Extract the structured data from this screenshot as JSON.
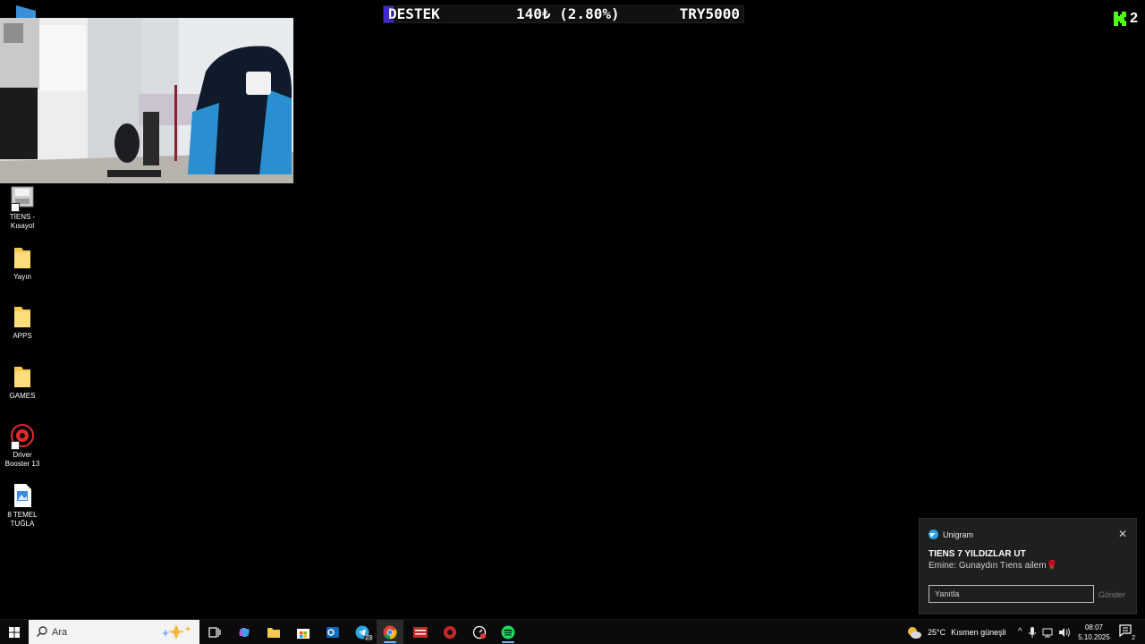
{
  "donation_bar": {
    "label": "DESTEK",
    "amount": "140₺ (2.80%)",
    "goal": "TRY5000",
    "progress_percent": 2.8,
    "accent": "#3b2bd1"
  },
  "kick": {
    "count": "2",
    "color": "#53fc18"
  },
  "desktop_icons": [
    {
      "label": "TİENS - Kısayol",
      "icon": "drive-shortcut-icon"
    },
    {
      "label": "Yayın",
      "icon": "folder-icon"
    },
    {
      "label": "APPS",
      "icon": "folder-icon"
    },
    {
      "label": "GAMES",
      "icon": "folder-icon"
    },
    {
      "label": "Driver Booster 13",
      "icon": "driver-booster-icon"
    },
    {
      "label": "8 TEMEL TUĞLA",
      "icon": "image-file-icon"
    }
  ],
  "toast": {
    "app": "Unigram",
    "title": "TIENS 7 YILDIZLAR UT",
    "message": "Emine: Gunaydın Tıens ailem🌹",
    "reply_placeholder": "Yanıtla",
    "send_label": "Gönder"
  },
  "taskbar": {
    "search_placeholder": "Ara",
    "telegram_badge": "23",
    "weather": {
      "temp": "25°C",
      "condition": "Kısmen güneşli"
    },
    "time": "08:07",
    "date": "5.10.2025",
    "notification_count": "2"
  }
}
